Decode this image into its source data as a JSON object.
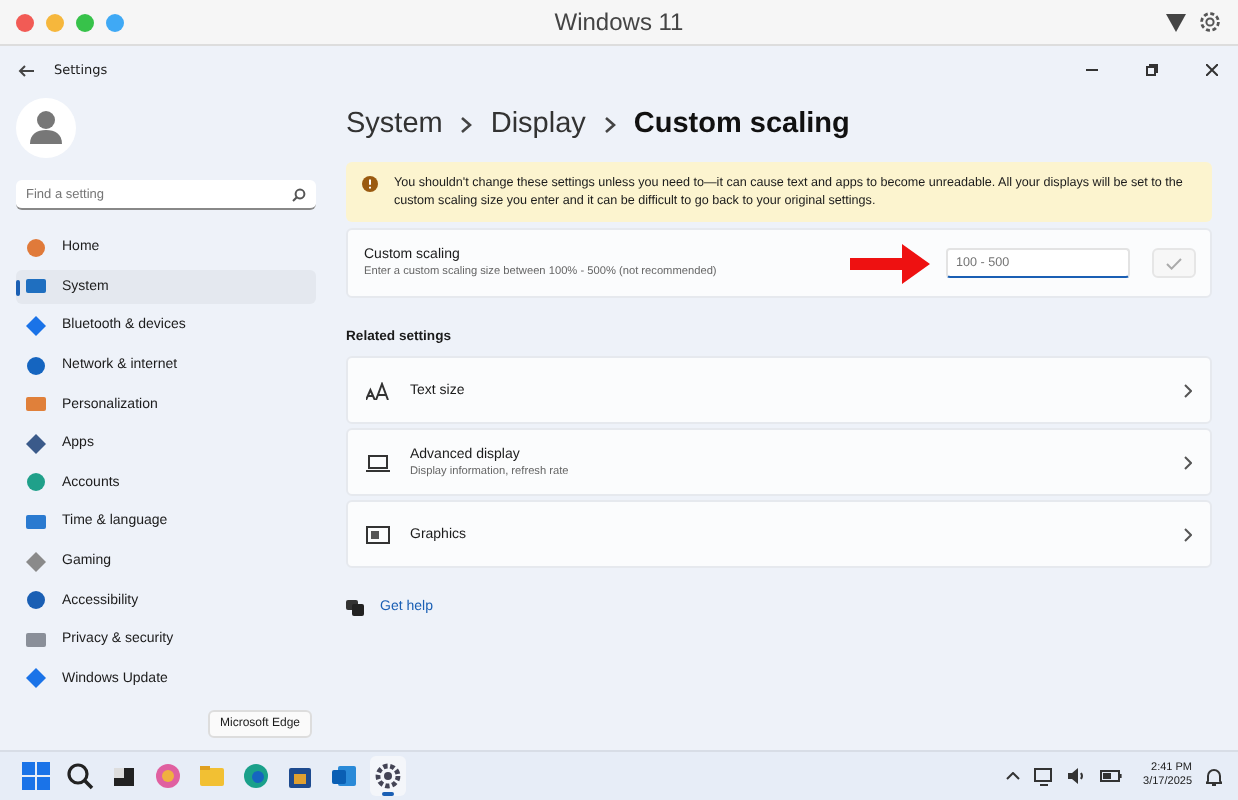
{
  "mac_window": {
    "title": "Windows 11"
  },
  "settings_window": {
    "title": "Settings"
  },
  "sidebar": {
    "search": {
      "placeholder": "Find a setting"
    },
    "items": [
      {
        "label": "Home",
        "selected": false
      },
      {
        "label": "System",
        "selected": true
      },
      {
        "label": "Bluetooth & devices",
        "selected": false
      },
      {
        "label": "Network & internet",
        "selected": false
      },
      {
        "label": "Personalization",
        "selected": false
      },
      {
        "label": "Apps",
        "selected": false
      },
      {
        "label": "Accounts",
        "selected": false
      },
      {
        "label": "Time & language",
        "selected": false
      },
      {
        "label": "Gaming",
        "selected": false
      },
      {
        "label": "Accessibility",
        "selected": false
      },
      {
        "label": "Privacy & security",
        "selected": false
      },
      {
        "label": "Windows Update",
        "selected": false
      }
    ]
  },
  "breadcrumb": [
    "System",
    "Display",
    "Custom scaling"
  ],
  "warning": {
    "text": "You shouldn't change these settings unless you need to—it can cause text and apps to become unreadable. All your displays will be set to the custom scaling size you enter and it can be difficult to go back to your original settings."
  },
  "custom_scaling": {
    "title": "Custom scaling",
    "description": "Enter a custom scaling size between 100% - 500% (not recommended)",
    "input": {
      "placeholder": "100 - 500"
    }
  },
  "related": {
    "heading": "Related settings",
    "items": [
      {
        "label": "Text size"
      },
      {
        "label": "Advanced display",
        "description": "Display information, refresh rate"
      },
      {
        "label": "Graphics"
      }
    ]
  },
  "help_link": "Get help",
  "tooltip": "Microsoft Edge",
  "taskbar": {
    "apps": [
      {
        "selected": false
      },
      {
        "selected": false
      },
      {
        "selected": false
      },
      {
        "selected": false
      },
      {
        "selected": false
      },
      {
        "selected": false
      },
      {
        "selected": false
      },
      {
        "selected": false
      },
      {
        "selected": true
      }
    ],
    "time": "2:41 PM",
    "date": "3/17/2025"
  }
}
